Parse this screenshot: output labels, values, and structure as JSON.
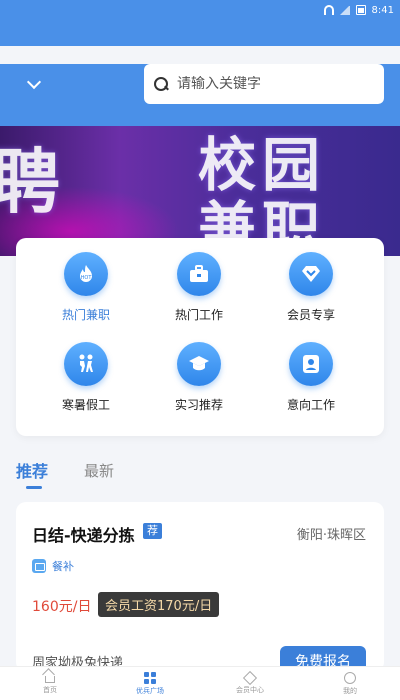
{
  "statusbar": {
    "time": "8:41"
  },
  "search": {
    "placeholder": "请输入关键字"
  },
  "banner": {
    "text_left": "聘",
    "text_mid": "校园",
    "text_low": "兼职"
  },
  "grid": {
    "items": [
      {
        "label": "热门兼职",
        "icon": "hot-icon"
      },
      {
        "label": "热门工作",
        "icon": "briefcase-icon"
      },
      {
        "label": "会员专享",
        "icon": "vip-diamond-icon"
      },
      {
        "label": "寒暑假工",
        "icon": "running-people-icon"
      },
      {
        "label": "实习推荐",
        "icon": "graduation-cap-icon"
      },
      {
        "label": "意向工作",
        "icon": "profile-card-icon"
      }
    ]
  },
  "tabs": [
    {
      "label": "推荐",
      "active": true
    },
    {
      "label": "最新",
      "active": false
    }
  ],
  "job": {
    "title": "日结-快递分拣",
    "badge": "荐",
    "location": "衡阳·珠晖区",
    "tag": "餐补",
    "salary": "160元/日",
    "vip_salary": "会员工资170元/日",
    "desc": "周家坳极兔快递",
    "signup_label": "免费报名"
  },
  "bottom_nav": [
    {
      "label": "首页",
      "active": false
    },
    {
      "label": "优兵广场",
      "active": true
    },
    {
      "label": "会员中心",
      "active": false
    },
    {
      "label": "我的",
      "active": false
    }
  ],
  "colors": {
    "primary": "#4a90e8",
    "accent": "#3b7fd9",
    "salary": "#e04a3a"
  }
}
